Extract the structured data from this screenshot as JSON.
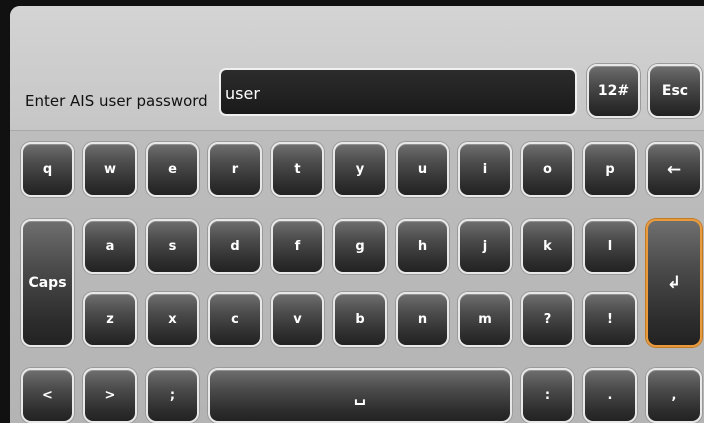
{
  "header": {
    "prompt": "Enter AIS user password",
    "password_value": "user",
    "numsym_label": "12#",
    "esc_label": "Esc"
  },
  "keyboard": {
    "row1": [
      "q",
      "w",
      "e",
      "r",
      "t",
      "y",
      "u",
      "i",
      "o",
      "p"
    ],
    "backspace_glyph": "←",
    "row2": [
      "a",
      "s",
      "d",
      "f",
      "g",
      "h",
      "j",
      "k",
      "l"
    ],
    "caps_label": "Caps",
    "enter_glyph": "↲",
    "row3": [
      "z",
      "x",
      "c",
      "v",
      "b",
      "n",
      "m",
      "?",
      "!"
    ],
    "row4_left": [
      "<",
      ">",
      ";"
    ],
    "space_glyph": "␣",
    "row4_right": [
      ":",
      ".",
      ","
    ]
  },
  "colors": {
    "enter_outline": "#e89a3c",
    "field_bg": "#1f1f1f"
  }
}
